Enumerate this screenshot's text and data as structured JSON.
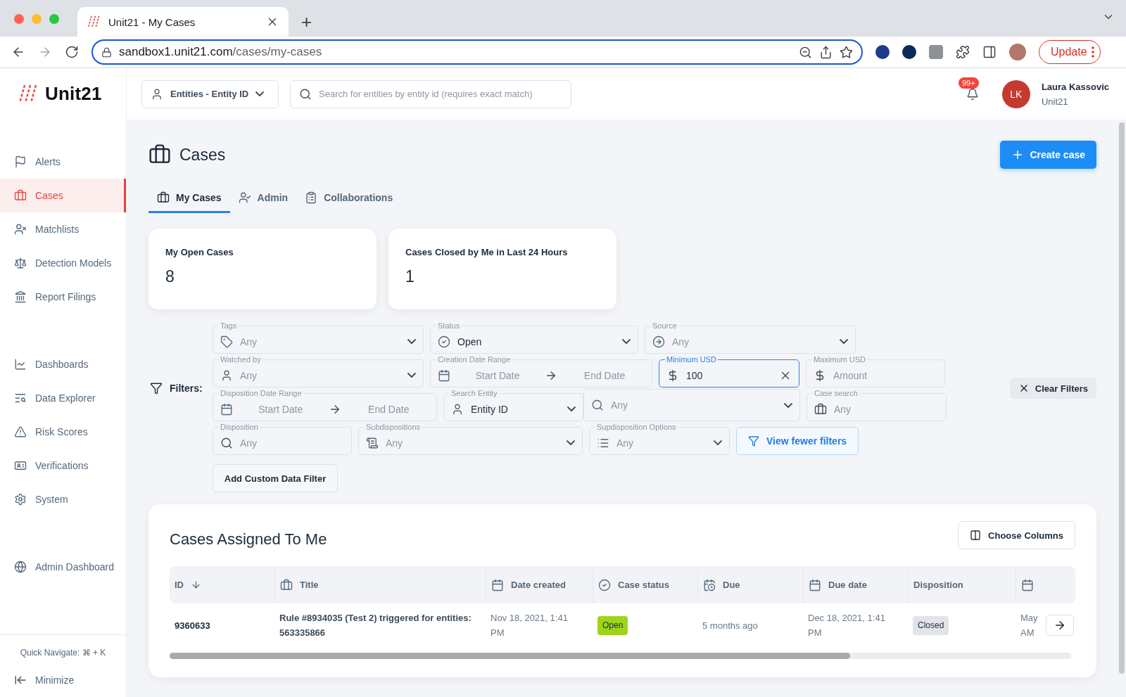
{
  "browser": {
    "tab_title": "Unit21 - My Cases",
    "new_tab": "+",
    "url_host": "sandbox1.unit21.com",
    "url_path": "/cases/my-cases",
    "update_button": "Update"
  },
  "header": {
    "logo": "Unit21",
    "entity_selector": "Entities - Entity ID",
    "search_placeholder": "Search for entities by entity id (requires exact match)",
    "notification_count": "99+",
    "user_initials": "LK",
    "user_name": "Laura Kassovic",
    "user_org": "Unit21"
  },
  "sidebar": {
    "sections": [
      {
        "items": [
          {
            "label": "Alerts",
            "selected": false
          },
          {
            "label": "Cases",
            "selected": true
          },
          {
            "label": "Matchlists",
            "selected": false
          },
          {
            "label": "Detection Models",
            "selected": false
          },
          {
            "label": "Report Filings",
            "selected": false
          }
        ]
      },
      {
        "items": [
          {
            "label": "Dashboards",
            "selected": false
          },
          {
            "label": "Data Explorer",
            "selected": false
          },
          {
            "label": "Risk Scores",
            "selected": false
          },
          {
            "label": "Verifications",
            "selected": false
          },
          {
            "label": "System",
            "selected": false
          }
        ]
      },
      {
        "items": [
          {
            "label": "Admin Dashboard",
            "selected": false
          }
        ]
      }
    ],
    "quick_navigate": "Quick Navigate: ⌘ + K",
    "minimize": "Minimize"
  },
  "page": {
    "title": "Cases",
    "create_button": "Create case",
    "tabs": [
      {
        "label": "My Cases",
        "selected": true
      },
      {
        "label": "Admin",
        "selected": false
      },
      {
        "label": "Collaborations",
        "selected": false
      }
    ],
    "stats": [
      {
        "label": "My Open Cases",
        "value": "8"
      },
      {
        "label": "Cases Closed by Me in Last 24 Hours",
        "value": "1"
      }
    ]
  },
  "filters": {
    "label": "Filters:",
    "rows": [
      {
        "fields": [
          {
            "kind": "select",
            "label": "Tags",
            "placeholder": "Any",
            "focused": false
          },
          {
            "kind": "select",
            "label": "Status",
            "value": "Open",
            "focused": false
          },
          {
            "kind": "select",
            "label": "Source",
            "placeholder": "Any",
            "focused": false
          }
        ]
      },
      {
        "fields": [
          {
            "kind": "select",
            "label": "Watched by",
            "placeholder": "Any",
            "focused": false
          },
          {
            "kind": "daterange",
            "label": "Creation Date Range",
            "start_placeholder": "Start Date",
            "end_placeholder": "End Date",
            "focused": false
          },
          {
            "kind": "money",
            "label": "Minimum USD",
            "value": "100",
            "focused": true
          },
          {
            "kind": "money",
            "label": "Maximum USD",
            "placeholder": "Amount",
            "focused": false
          }
        ]
      },
      {
        "fields": [
          {
            "kind": "daterange",
            "label": "Disposition Date Range",
            "start_placeholder": "Start Date",
            "end_placeholder": "End Date",
            "focused": false
          },
          {
            "kind": "select",
            "label": "Search Entity",
            "value": "Entity ID",
            "focused": false
          },
          {
            "kind": "select",
            "placeholder": "Any",
            "focused": false
          },
          {
            "kind": "input",
            "label": "Case search",
            "placeholder": "Any",
            "focused": false
          }
        ]
      },
      {
        "fields": [
          {
            "kind": "input",
            "label": "Disposition",
            "placeholder": "Any",
            "focused": false
          },
          {
            "kind": "select",
            "label": "Subdispositions",
            "placeholder": "Any",
            "focused": false
          },
          {
            "kind": "select",
            "label": "Supdisposition Options",
            "placeholder": "Any",
            "focused": false
          }
        ]
      }
    ],
    "view_toggle": "View fewer filters",
    "clear_button": "Clear Filters",
    "add_custom_button": "Add Custom Data Filter"
  },
  "table": {
    "title": "Cases Assigned To Me",
    "choose_columns": "Choose Columns",
    "columns": [
      {
        "label": "ID",
        "sorted": true
      },
      {
        "label": "Title",
        "sorted": false
      },
      {
        "label": "Date created",
        "sorted": false
      },
      {
        "label": "Case status",
        "sorted": false
      },
      {
        "label": "Due",
        "sorted": false
      },
      {
        "label": "Due date",
        "sorted": false
      },
      {
        "label": "Disposition",
        "sorted": false
      },
      {
        "sorted": false
      }
    ],
    "rows": [
      {
        "cells": [
          {
            "kind": "id",
            "text": "9360633"
          },
          {
            "kind": "title",
            "text": "Rule #8934035 (Test 2) triggered for entities: 563335866"
          },
          {
            "kind": "text",
            "text": "Nov 18, 2021, 1:41 PM"
          },
          {
            "kind": "badge",
            "text": "Open",
            "color": "#9fd41c"
          },
          {
            "kind": "text",
            "text": "5 months ago"
          },
          {
            "kind": "text",
            "text": "Dec 18, 2021, 1:41 PM"
          },
          {
            "kind": "badge",
            "text": "Closed",
            "color": "#e1e4e8"
          },
          {
            "kind": "text",
            "text": "May AM"
          }
        ]
      }
    ]
  }
}
